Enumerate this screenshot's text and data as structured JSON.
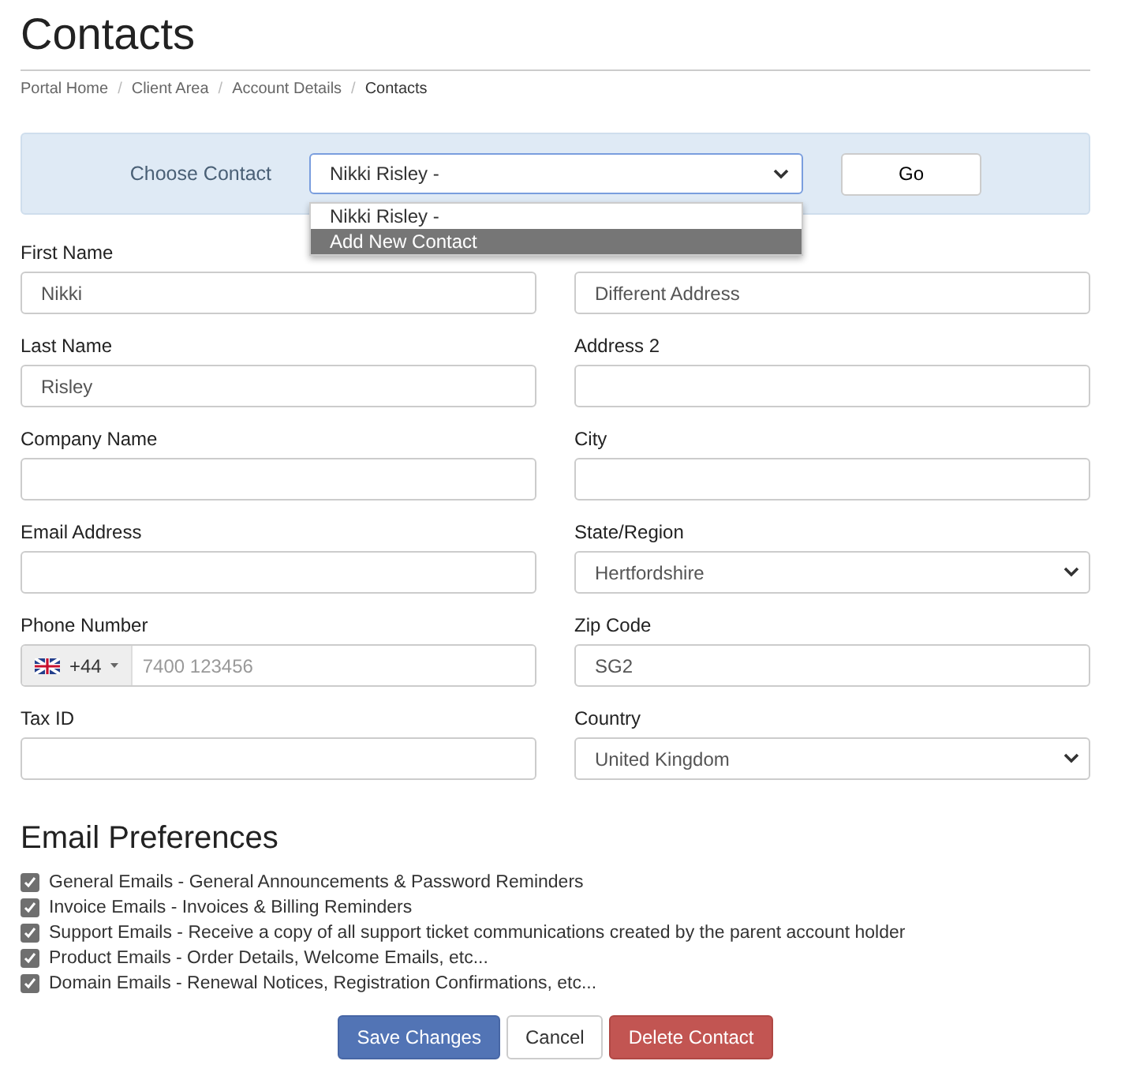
{
  "title": "Contacts",
  "breadcrumb": [
    {
      "label": "Portal Home",
      "current": false,
      "separator": "/"
    },
    {
      "label": "Client Area",
      "current": false,
      "separator": "/"
    },
    {
      "label": "Account Details",
      "current": false,
      "separator": "/"
    },
    {
      "label": "Contacts",
      "current": true
    }
  ],
  "choose_contact": {
    "label": "Choose Contact",
    "value": "Nikki Risley -",
    "expanded": true,
    "options": [
      {
        "label": "Nikki Risley -",
        "highlighted": false
      },
      {
        "label": "Add New Contact",
        "highlighted": true
      }
    ],
    "go_button": "Go"
  },
  "left_fields": [
    {
      "kind": "text",
      "label": "First Name",
      "value": "Nikki"
    },
    {
      "kind": "text",
      "label": "Last Name",
      "value": "Risley"
    },
    {
      "kind": "text",
      "label": "Company Name"
    },
    {
      "kind": "text",
      "label": "Email Address"
    },
    {
      "kind": "phone",
      "label": "Phone Number",
      "country_code": "+44",
      "placeholder": "7400 123456"
    },
    {
      "kind": "text",
      "label": "Tax ID"
    }
  ],
  "right_fields": [
    {
      "kind": "text",
      "value": "Different Address"
    },
    {
      "kind": "text",
      "label": "Address 2"
    },
    {
      "kind": "text",
      "label": "City"
    },
    {
      "kind": "select",
      "label": "State/Region",
      "value": "Hertfordshire"
    },
    {
      "kind": "text",
      "label": "Zip Code",
      "value": "SG2"
    },
    {
      "kind": "select",
      "label": "Country",
      "value": "United Kingdom"
    }
  ],
  "email_preferences": {
    "heading": "Email Preferences",
    "items": [
      {
        "label": "General Emails - General Announcements & Password Reminders",
        "checked": true
      },
      {
        "label": "Invoice Emails - Invoices & Billing Reminders",
        "checked": true
      },
      {
        "label": "Support Emails - Receive a copy of all support ticket communications created by the parent account holder",
        "checked": true
      },
      {
        "label": "Product Emails - Order Details, Welcome Emails, etc...",
        "checked": true
      },
      {
        "label": "Domain Emails - Renewal Notices, Registration Confirmations, etc...",
        "checked": true
      }
    ]
  },
  "buttons": [
    {
      "kind": "primary",
      "label": "Save Changes"
    },
    {
      "kind": "default",
      "label": "Cancel"
    },
    {
      "kind": "danger",
      "label": "Delete Contact"
    }
  ]
}
